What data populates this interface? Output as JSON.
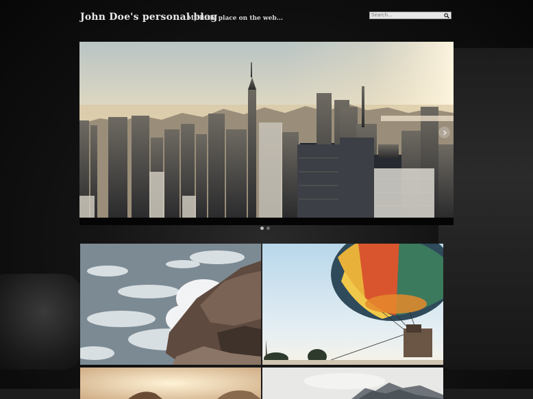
{
  "header": {
    "title": "John Doe's personal blog",
    "tagline": "My little place on the web..."
  },
  "search": {
    "placeholder": "Search...",
    "button_icon": "magnifier-icon"
  },
  "slider": {
    "slide_subject": "city-skyline",
    "next_icon": "chevron-right-icon",
    "dots": [
      {
        "active": true
      },
      {
        "active": false
      }
    ]
  },
  "gallery": {
    "tiles": [
      {
        "subject": "waves-on-rocks"
      },
      {
        "subject": "hot-air-balloon"
      },
      {
        "subject": "sunlit-landscape"
      },
      {
        "subject": "misty-mountain"
      }
    ]
  },
  "colors": {
    "page_background": "#0b0b0b",
    "title_text": "#e9e9e9",
    "tagline_text": "#d6d6d6"
  }
}
